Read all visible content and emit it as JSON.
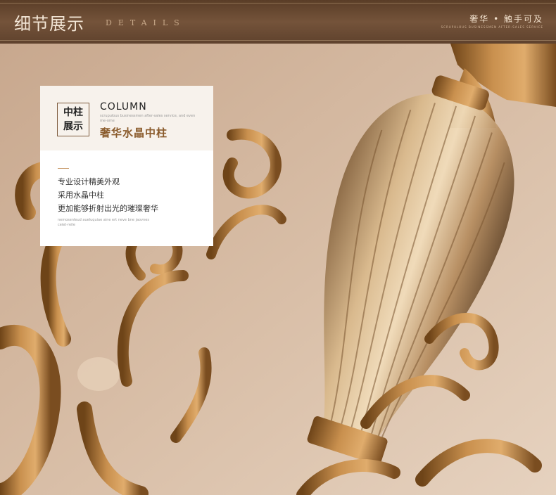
{
  "banner": {
    "title": "细节展示",
    "subtitle": "DETAILS",
    "slogan": "奢华 • 触手可及",
    "tiny_text": "SCRUPULOUS BUSINESSMEN AFTER-SALES SERVICE"
  },
  "card": {
    "label_line1": "中柱",
    "label_line2": "展示",
    "title": "COLUMN",
    "english_small": "scrupulous businessmen after-sales service, and even me-ome",
    "subtitle_cn": "奢华水晶中柱",
    "features": [
      "专业设计精美外观",
      "采用水晶中柱",
      "更加能够折射出光的璀璨奢华"
    ],
    "english_footer": "nemosenleud aueluquiae aine ert neve bne jaovnes ceiet-reile"
  },
  "colors": {
    "banner": "#5f422d",
    "accent": "#8a5b2c",
    "brass": "#b07a3e"
  },
  "image_description": "Close-up of a brass chandelier with a ribbed amber crystal central column"
}
